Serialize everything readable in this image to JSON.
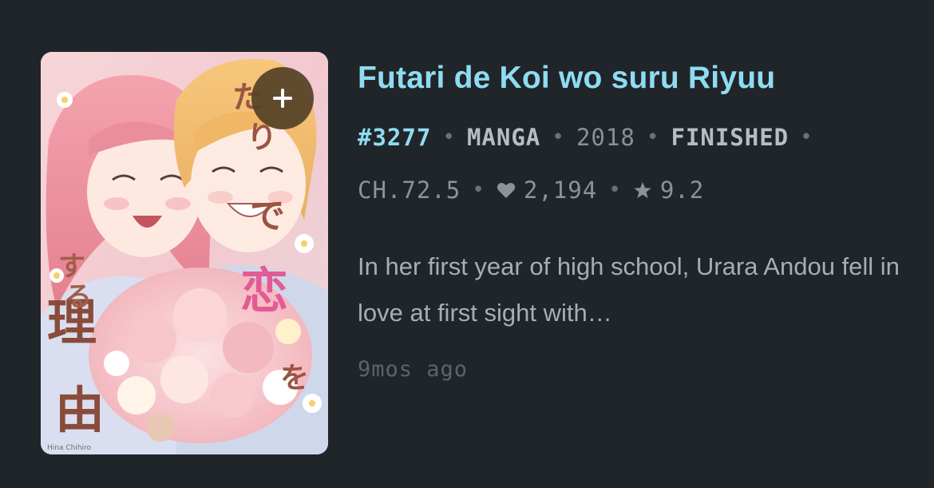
{
  "entry": {
    "title": "Futari de Koi wo suru Riyuu",
    "id": "#3277",
    "format": "MANGA",
    "year": "2018",
    "status": "FINISHED",
    "chapter": "CH.72.5",
    "favorites": "2,194",
    "rating": "9.2",
    "description": "In her first year of high school, Urara Andou fell in love at first sight with…",
    "updated": "9mos ago"
  },
  "cover": {
    "title_text": "ふたりで恋をする理由",
    "author_text": "Hina Chihiro"
  },
  "icons": {
    "add": "plus-icon",
    "favorites": "heart-icon",
    "rating": "star-icon"
  },
  "colors": {
    "background": "#202529",
    "accent": "#8fdcf2",
    "add_button": "#524126"
  }
}
